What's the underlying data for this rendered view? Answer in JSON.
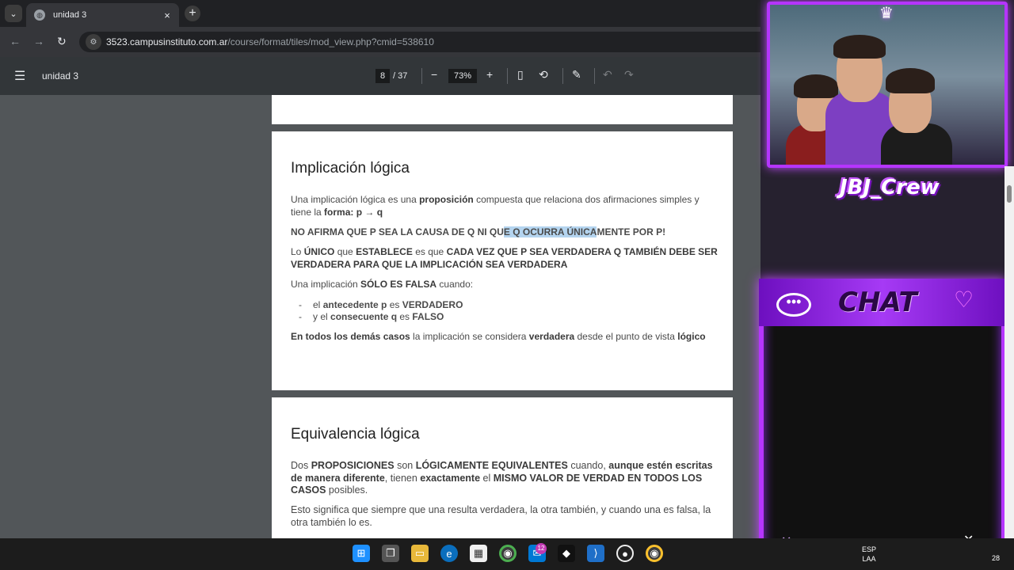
{
  "browser": {
    "tab_title": "unidad 3",
    "tab_close": "×",
    "new_tab": "+",
    "tab_menu": "⌄",
    "url_host": "3523.campusinstituto.com.ar",
    "url_path": "/course/format/tiles/mod_view.php?cmid=538610"
  },
  "pdf_toolbar": {
    "doc_title": "unidad 3",
    "current_page": "8",
    "total_pages": "/ 37",
    "zoom": "73%",
    "zoom_out": "−",
    "zoom_in": "+"
  },
  "page2": {
    "heading": "Implicación lógica",
    "p1_a": "Una implicación lógica es una ",
    "p1_b": "proposición",
    "p1_c": " compuesta que relaciona dos afirmaciones simples y tiene la ",
    "p1_d": "forma: p → q",
    "p2_a": "NO AFIRMA QUE P SEA LA CAUSA DE Q NI QU",
    "p2_hl": "E Q OCURRA ÚNICA",
    "p2_b": "MENTE POR P!",
    "p3_a": "Lo ",
    "p3_b": "ÚNICO",
    "p3_c": " que ",
    "p3_d": "ESTABLECE",
    "p3_e": " es que ",
    "p3_f": "CADA VEZ QUE P SEA VERDADERA Q TAMBIÉN DEBE SER VERDADERA PARA QUE LA IMPLICACIÓN SEA VERDADERA",
    "p4_a": "Una implicación ",
    "p4_b": "SÓLO ES FALSA",
    "p4_c": " cuando:",
    "b1_a": "el ",
    "b1_b": "antecedente p",
    "b1_c": " es ",
    "b1_d": "VERDADERO",
    "b2_a": "y el ",
    "b2_b": "consecuente q",
    "b2_c": " es ",
    "b2_d": "FALSO",
    "p5_a": "En todos los demás casos",
    "p5_b": " la implicación se considera ",
    "p5_c": "verdadera",
    "p5_d": " desde el punto de vista ",
    "p5_e": "lógico"
  },
  "page3": {
    "heading": "Equivalencia lógica",
    "p1_a": "Dos ",
    "p1_b": "PROPOSICIONES",
    "p1_c": " son ",
    "p1_d": "LÓGICAMENTE EQUIVALENTES",
    "p1_e": "  cuando, ",
    "p1_f": "aunque estén escritas de manera diferente",
    "p1_g": ", tienen ",
    "p1_h": "exactamente",
    "p1_i": " el  ",
    "p1_j": "MISMO  VALOR DE VERDAD EN TODOS LOS CASOS",
    "p1_k": " posibles.",
    "p2": "Esto significa que siempre que una resulta verdadera, la otra también, y cuando una es falsa, la otra también lo es."
  },
  "overlay": {
    "crew_label": "JBJ_Crew",
    "chat_label": "CHAT",
    "bubble": "•••"
  },
  "taskbar": {
    "badge_count": "12",
    "tray_line1": "ESP",
    "tray_line2": "LAA",
    "tray_time": "28"
  }
}
